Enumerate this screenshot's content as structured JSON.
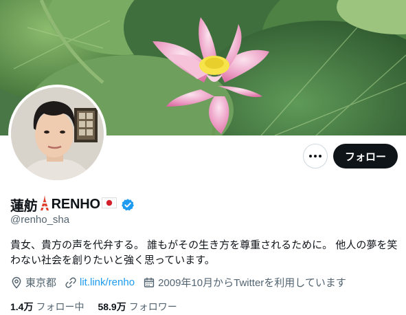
{
  "profile": {
    "display_name_prefix": "蓮舫",
    "display_name_main": "RENHO",
    "handle": "@renho_sha",
    "bio": "貴女、貴方の声を代弁する。 誰もがその生き方を尊重されるために。 他人の夢を笑わない社会を創りたいと強く思っています。",
    "location": "東京都",
    "link": "lit.link/renho",
    "joined": "2009年10月からTwitterを利用しています"
  },
  "actions": {
    "follow_label": "フォロー"
  },
  "stats": {
    "following_count": "1.4万",
    "following_label": "フォロー中",
    "followers_count": "58.9万",
    "followers_label": "フォロワー"
  },
  "colors": {
    "accent": "#1d9bf0",
    "text": "#0f1419",
    "muted": "#536471",
    "button_dark": "#0f1419"
  },
  "icons": {
    "name_emoji_1": "tokyo-tower-icon",
    "name_emoji_2": "japan-flag-icon",
    "verified": "verified-badge-icon",
    "location": "location-pin-icon",
    "link": "link-icon",
    "joined": "calendar-icon",
    "more": "more-icon"
  }
}
